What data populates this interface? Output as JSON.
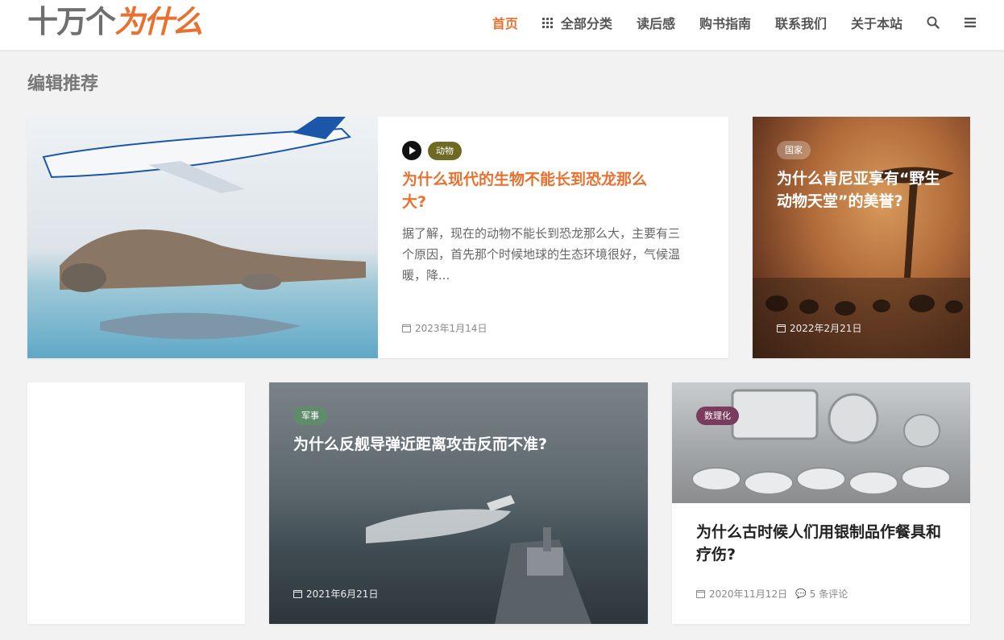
{
  "site": {
    "logo_part1": "十万个",
    "logo_part2": "为什么"
  },
  "nav": {
    "home": "首页",
    "categories": "全部分类",
    "reviews": "读后感",
    "guide": "购书指南",
    "contact": "联系我们",
    "about": "关于本站"
  },
  "section_title": "编辑推荐",
  "colors": {
    "accent": "#e8712f",
    "background": "#f2f2f2"
  },
  "featured": {
    "badge": "动物",
    "title": "为什么现代的生物不能长到恐龙那么大?",
    "excerpt": "据了解，现在的动物不能长到恐龙那么大，主要有三个原因，首先那个时候地球的生态环境很好，气候温暖，降...",
    "date": "2023年1月14日"
  },
  "kenya": {
    "badge": "国家",
    "title": "为什么肯尼亚享有“野生动物天堂”的美誉?",
    "date": "2022年2月21日"
  },
  "missile": {
    "badge": "军事",
    "title": "为什么反舰导弹近距离攻击反而不准?",
    "date": "2021年6月21日"
  },
  "silver": {
    "badge": "数理化",
    "title": "为什么古时候人们用银制品作餐具和疗伤?",
    "date": "2020年11月12日",
    "comments": "5 条评论"
  }
}
